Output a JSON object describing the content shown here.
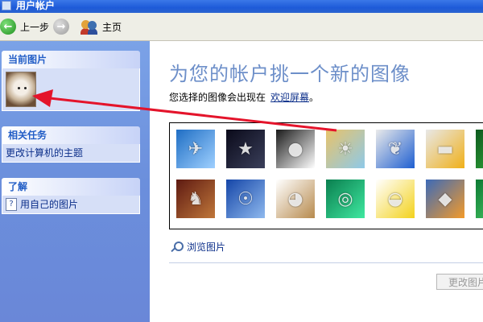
{
  "window": {
    "title": "用户帐户"
  },
  "toolbar": {
    "back_label": "上一步",
    "home_label": "主页"
  },
  "sidebar": {
    "current_picture": {
      "heading": "当前图片"
    },
    "tasks": {
      "heading": "相关任务",
      "items": [
        {
          "label": "更改计算机的主题"
        }
      ]
    },
    "learn": {
      "heading": "了解",
      "items": [
        {
          "label": "用自己的图片"
        }
      ]
    }
  },
  "main": {
    "title": "为您的帐户挑一个新的图像",
    "subtitle": "您选择的图像会出现在",
    "subtitle_link": "欢迎屏幕",
    "subtitle_end": "。",
    "browse_label": "浏览图片",
    "change_button": "更改图片",
    "pictures": [
      {
        "icon": "airplane",
        "colors": [
          "#1f6ec4",
          "#9fd0ff"
        ]
      },
      {
        "icon": "astronaut",
        "colors": [
          "#0a0a1a",
          "#3a3f5a"
        ]
      },
      {
        "icon": "soccer-ball",
        "colors": [
          "#1a1a1a",
          "#ffffff"
        ]
      },
      {
        "icon": "beach-chairs",
        "colors": [
          "#e8c36a",
          "#8ec9e8"
        ]
      },
      {
        "icon": "butterfly",
        "colors": [
          "#eaeaea",
          "#1f5fd1"
        ]
      },
      {
        "icon": "race-car",
        "colors": [
          "#e8e8e8",
          "#f0b019"
        ]
      },
      {
        "icon": "frog",
        "colors": [
          "#0d5a1f",
          "#37b33d"
        ]
      },
      {
        "icon": "chess",
        "colors": [
          "#5e1a12",
          "#c0773a"
        ]
      },
      {
        "icon": "bmx-rider",
        "colors": [
          "#1546a8",
          "#8fb9ee"
        ]
      },
      {
        "icon": "dog",
        "colors": [
          "#ffffff",
          "#b78a4d"
        ]
      },
      {
        "icon": "green-drop",
        "colors": [
          "#0a7f4f",
          "#3fe8a0"
        ]
      },
      {
        "icon": "rubber-duck",
        "colors": [
          "#ffffff",
          "#f3d21c"
        ]
      },
      {
        "icon": "fish",
        "colors": [
          "#3c6ab8",
          "#f39a2a"
        ]
      },
      {
        "icon": "flower",
        "colors": [
          "#0c7a34",
          "#4fd26a"
        ]
      }
    ]
  }
}
